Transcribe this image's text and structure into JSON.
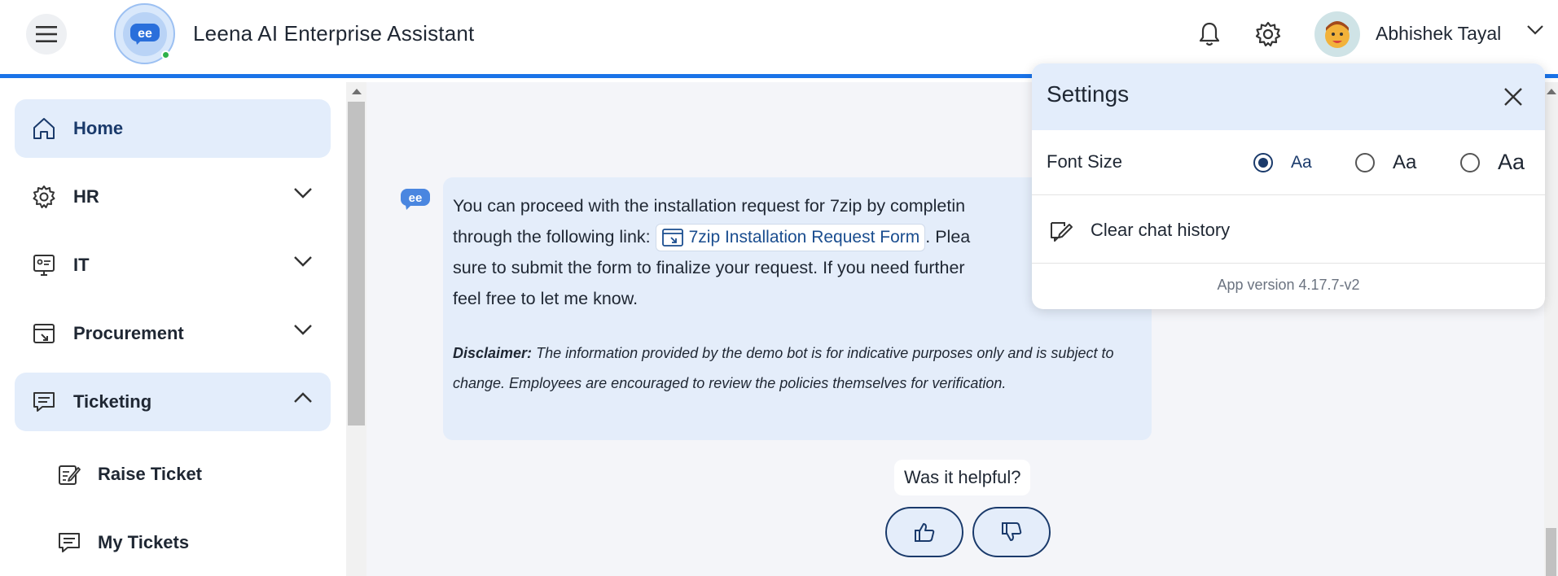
{
  "header": {
    "title": "Leena AI Enterprise Assistant",
    "user_name": "Abhishek Tayal",
    "icons": [
      "menu-icon",
      "bell-icon",
      "gear-icon",
      "chevron-down-icon"
    ]
  },
  "sidebar": {
    "items": [
      {
        "label": "Home",
        "icon": "home-icon",
        "active": true
      },
      {
        "label": "HR",
        "icon": "hr-gear-icon",
        "expandable": true
      },
      {
        "label": "IT",
        "icon": "it-icon",
        "expandable": true
      },
      {
        "label": "Procurement",
        "icon": "procurement-icon",
        "expandable": true
      },
      {
        "label": "Ticketing",
        "icon": "ticketing-icon",
        "expanded": true
      }
    ],
    "sub_items": [
      {
        "label": "Raise Ticket",
        "icon": "edit-ticket-icon"
      },
      {
        "label": "My Tickets",
        "icon": "tickets-icon"
      }
    ]
  },
  "chat": {
    "message_line1": "You can proceed with the installation request for 7zip by completin",
    "message_line2_prefix": "through the following link:",
    "link_text": "7zip Installation Request Form",
    "message_line2_suffix": ". Plea",
    "message_line3": "sure to submit the form to finalize your request. If you need further",
    "message_line4": "feel free to let me know.",
    "disclaimer_label": "Disclaimer:",
    "disclaimer_text": "The information provided by the demo bot is for indicative purposes only and is subject to change. Employees are encouraged to review the policies themselves for verification.",
    "helpful_prompt": "Was it helpful?"
  },
  "settings": {
    "title": "Settings",
    "font_size_label": "Font Size",
    "font_options": [
      {
        "label": "Aa",
        "selected": true
      },
      {
        "label": "Aa",
        "selected": false
      },
      {
        "label": "Aa",
        "selected": false
      }
    ],
    "clear_history_label": "Clear chat history",
    "app_version": "App version 4.17.7-v2"
  },
  "colors": {
    "accent": "#1a73e8",
    "active_nav": "#e3edfb",
    "bubble": "#e4edfa",
    "dark_navy": "#1a3a6b"
  }
}
